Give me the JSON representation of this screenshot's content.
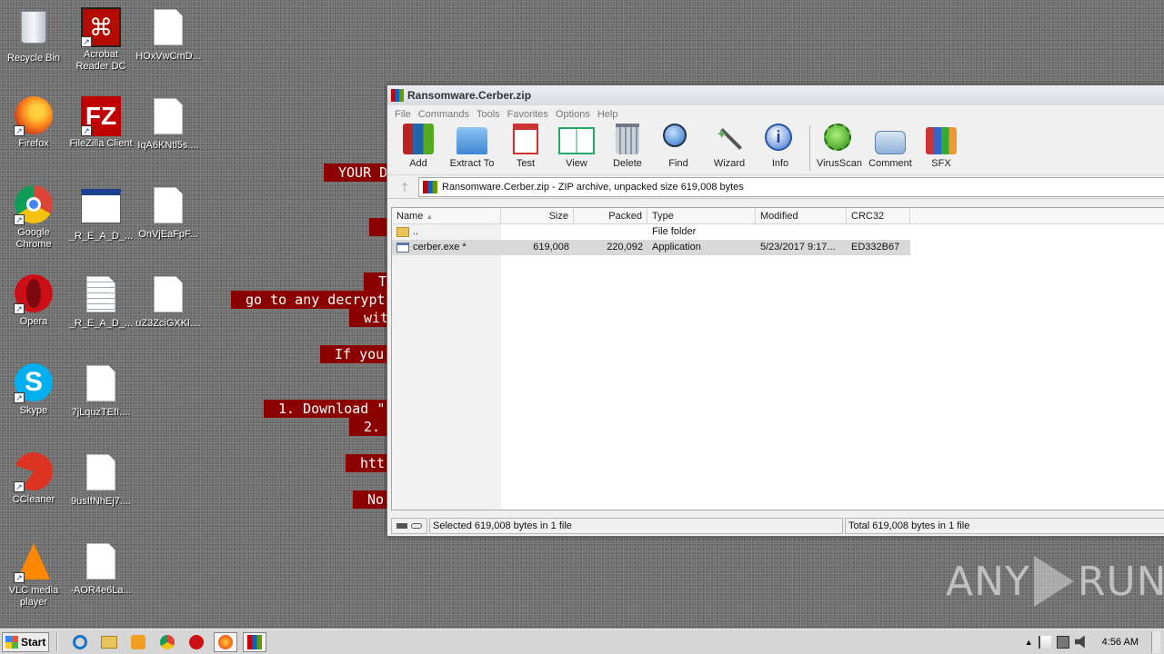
{
  "desktop": {
    "icons": [
      {
        "label": "Recycle Bin",
        "icon": "recycle-bin-icon"
      },
      {
        "label": "Acrobat Reader DC",
        "icon": "acrobat-icon"
      },
      {
        "label": "HOxVwCmD...",
        "icon": "file-icon"
      },
      {
        "label": "Firefox",
        "icon": "firefox-icon"
      },
      {
        "label": "FileZilla Client",
        "icon": "filezilla-icon"
      },
      {
        "label": "IqA6KNtl5s....",
        "icon": "file-icon"
      },
      {
        "label": "Google Chrome",
        "icon": "chrome-icon"
      },
      {
        "label": "_R_E_A_D_...",
        "icon": "hta-icon"
      },
      {
        "label": "OnVjEaFpF...",
        "icon": "file-icon"
      },
      {
        "label": "Opera",
        "icon": "opera-icon"
      },
      {
        "label": "_R_E_A_D_...",
        "icon": "text-file-icon"
      },
      {
        "label": "uZ3ZciGXKl....",
        "icon": "file-icon"
      },
      {
        "label": "Skype",
        "icon": "skype-icon"
      },
      {
        "label": "7jLquzTEfI....",
        "icon": "file-icon"
      },
      {
        "label": "CCleaner",
        "icon": "ccleaner-icon"
      },
      {
        "label": "9usIfNhEj7....",
        "icon": "file-icon"
      },
      {
        "label": "VLC media player",
        "icon": "vlc-icon"
      },
      {
        "label": "-AOR4e6La...",
        "icon": "file-icon"
      }
    ],
    "ransom_lines": [
      "YOUR D",
      "T",
      "go to any decrypt",
      "wit",
      "If you",
      "1. Download \"",
      "2.",
      "htt",
      "No"
    ]
  },
  "window": {
    "title": "Ransomware.Cerber.zip",
    "menu": [
      "File",
      "Commands",
      "Tools",
      "Favorites",
      "Options",
      "Help"
    ],
    "toolbar": [
      "Add",
      "Extract To",
      "Test",
      "View",
      "Delete",
      "Find",
      "Wizard",
      "Info",
      "VirusScan",
      "Comment",
      "SFX"
    ],
    "address": "Ransomware.Cerber.zip - ZIP archive, unpacked size 619,008 bytes",
    "columns": {
      "name": "Name",
      "size": "Size",
      "packed": "Packed",
      "type": "Type",
      "modified": "Modified",
      "crc": "CRC32"
    },
    "rows": [
      {
        "name": "..",
        "size": "",
        "packed": "",
        "type": "File folder",
        "modified": "",
        "crc": ""
      },
      {
        "name": "cerber.exe *",
        "size": "619,008",
        "packed": "220,092",
        "type": "Application",
        "modified": "5/23/2017 9:17...",
        "crc": "ED332B67"
      }
    ],
    "status_selected": "Selected 619,008 bytes in 1 file",
    "status_total": "Total 619,008 bytes in 1 file"
  },
  "watermark": {
    "left": "ANY",
    "right": "RUN"
  },
  "taskbar": {
    "start_label": "Start",
    "clock": "4:56 AM",
    "tray_up": "▲"
  }
}
